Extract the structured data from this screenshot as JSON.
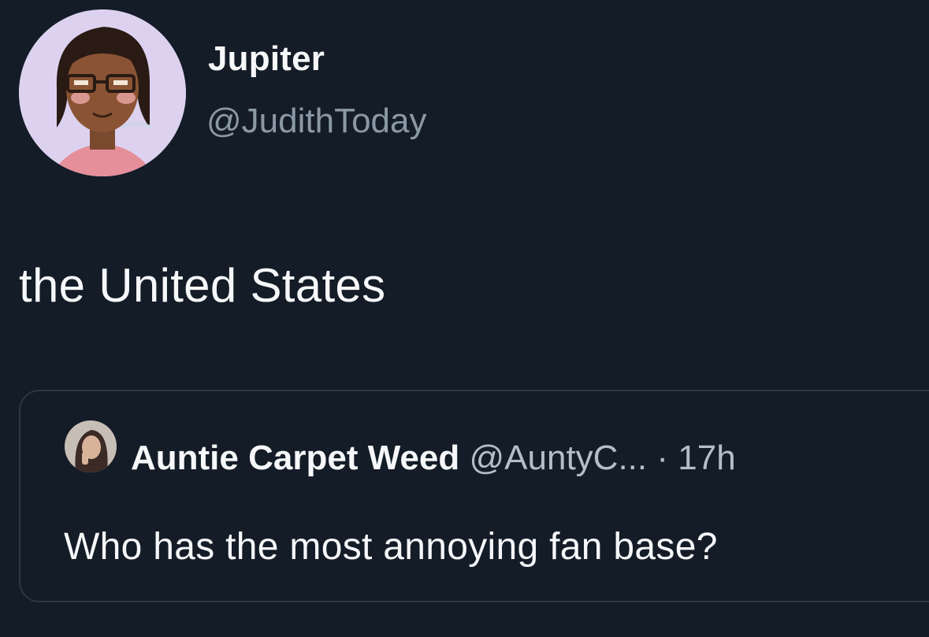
{
  "tweet": {
    "author": {
      "display_name": "Jupiter",
      "handle": "@JudithToday",
      "avatar_icon": "cartoon-woman-avatar"
    },
    "text": "the United States",
    "quoted_tweet": {
      "author": {
        "display_name": "Auntie Carpet Weed",
        "handle": "@AuntyC...",
        "avatar_icon": "photo-avatar"
      },
      "separator": "·",
      "time": "17h",
      "text": "Who has the most annoying fan base?"
    }
  },
  "colors": {
    "background": "#141c27",
    "text_primary": "#f5f7f9",
    "text_secondary": "#8b98a5",
    "border": "#2c3642"
  }
}
